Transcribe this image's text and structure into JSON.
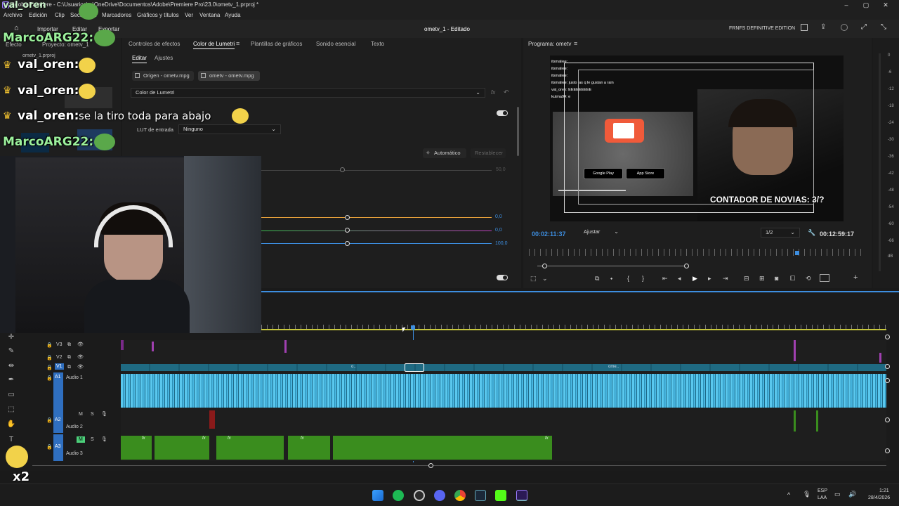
{
  "titlebar": {
    "title": "Adobe Premiere - C:\\Usuarios\\...\\OneDrive\\Documentos\\Adobe\\Premiere Pro\\23.0\\ometv_1.prproj *",
    "minimize": "–",
    "maximize": "▢",
    "close": "✕"
  },
  "menu": [
    "Archivo",
    "Edición",
    "Clip",
    "Secuencia",
    "Marcadores",
    "Gráficos y títulos",
    "Ver",
    "Ventana",
    "Ayuda"
  ],
  "workspace": {
    "home": "⌂",
    "import": "Importar",
    "edit": "Editar",
    "export": "Exportar",
    "project_title": "ometv_1 - Editado",
    "edition": "FRNFS DEFINITIVE EDITION"
  },
  "left_panel": {
    "tab_effect": "Efecto",
    "tab_project": "Proyecto: ometv_1",
    "project_file": "ometv_1.prproj"
  },
  "effect_panel": {
    "tabs": [
      "Controles de efectos",
      "Color de Lumetri",
      "Plantillas de gráficos",
      "Sonido esencial",
      "Texto"
    ],
    "active_tab": "Color de Lumetri",
    "subtabs": [
      "Editar",
      "Ajustes"
    ],
    "source_btn": "Origen - ometv.mpg",
    "sequence_btn": "ometv - ometv.mpg",
    "effect_dropdown": "Color de Lumetri",
    "fx_label": "fx",
    "lut_label": "LUT de entrada",
    "lut_value": "Ninguno",
    "auto_btn": "Automático",
    "reset_btn": "Restablecer",
    "value_top": "50,0",
    "value_1": "0,0",
    "value_2": "0,0",
    "value_3": "100,0"
  },
  "program": {
    "title": "Programa: ometv",
    "timecode_current": "00:02:11:37",
    "fit": "Ajustar",
    "resolution": "1/2",
    "timecode_total": "00:12:59:17",
    "video_overlay_text": "CONTADOR DE NOVIAS: 3/?",
    "video_chat": [
      "itsmaliee: ",
      "itsmaliee: ",
      "itsmaliee: ",
      "itsmaliee: justo las q le gustan a rain",
      "val_oren: EEEEEEEEE",
      "kutma94: e"
    ],
    "store_badges": [
      "Google Play",
      "App Store"
    ]
  },
  "meter_labels": [
    "0",
    "-6",
    "-12",
    "-18",
    "-24",
    "-30",
    "-36",
    "-42",
    "-48",
    "-54",
    "-60",
    "-66",
    "dB"
  ],
  "stream_chat": [
    {
      "name": "MarcoARG22:",
      "color": "green",
      "message": ""
    },
    {
      "name": "val_oren:",
      "color": "white",
      "message": ""
    },
    {
      "name": "val_oren:",
      "color": "white",
      "message": ""
    },
    {
      "name": "val_oren:",
      "color": "white",
      "message": "se la tiro toda para abajo"
    },
    {
      "name": "MarcoARG22:",
      "color": "green",
      "message": ""
    }
  ],
  "overlay_top_text": "val_oren",
  "multiplier": "x2",
  "timeline": {
    "tracks": [
      {
        "id": "V3",
        "name": ""
      },
      {
        "id": "V2",
        "name": ""
      },
      {
        "id": "V1",
        "name": ""
      },
      {
        "id": "A1",
        "name": "Audio 1"
      },
      {
        "id": "A2",
        "name": "Audio 2"
      },
      {
        "id": "A3",
        "name": "Audio 3"
      }
    ],
    "clip_labels": [
      "o..",
      "ome..",
      "fx"
    ],
    "m_label": "M",
    "s_label": "S"
  },
  "taskbar": {
    "lang": "ESP",
    "lang2": "LAA",
    "time": "1:21",
    "date": "28/4/2026"
  },
  "colors": {
    "accent_blue": "#3d8ee0",
    "audio_cyan": "#4ec3e8",
    "audio_green": "#3a8d1e",
    "panel": "#1e1e1e"
  }
}
